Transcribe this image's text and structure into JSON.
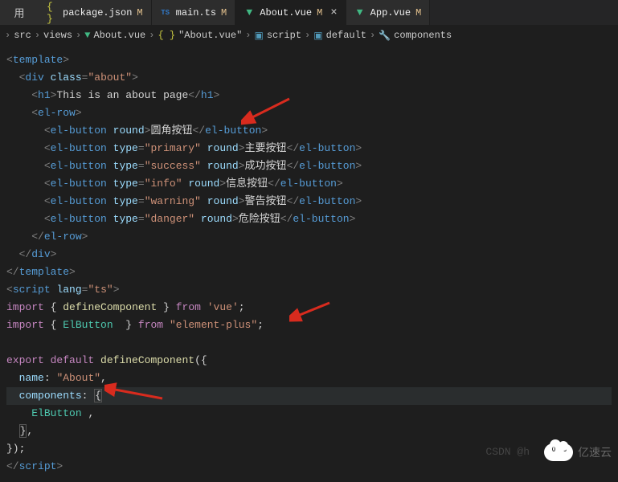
{
  "tabs": {
    "first": "用",
    "items": [
      {
        "icon": "json",
        "label": "package.json",
        "modified": "M",
        "active": false,
        "close": false
      },
      {
        "icon": "ts",
        "label": "main.ts",
        "modified": "M",
        "active": false,
        "close": false
      },
      {
        "icon": "vue",
        "label": "About.vue",
        "modified": "M",
        "active": true,
        "close": true
      },
      {
        "icon": "vue",
        "label": "App.vue",
        "modified": "M",
        "active": false,
        "close": false
      }
    ]
  },
  "breadcrumb": {
    "sep": "›",
    "items": [
      "src",
      "views",
      "About.vue",
      "\"About.vue\"",
      "script",
      "default",
      "components"
    ],
    "icons": [
      "",
      "",
      "vue",
      "braces",
      "cube",
      "cube",
      "wrench"
    ]
  },
  "code": {
    "l1": {
      "tag": "template"
    },
    "l2": {
      "tag": "div",
      "attr": "class",
      "val": "\"about\""
    },
    "l3": {
      "tag": "h1",
      "text": "This is an about page"
    },
    "l4": {
      "tag": "el-row"
    },
    "l5": {
      "tag": "el-button",
      "attr1": "round",
      "text": "圆角按钮"
    },
    "l6": {
      "tag": "el-button",
      "attr1": "type",
      "val1": "\"primary\"",
      "attr2": "round",
      "text": "主要按钮"
    },
    "l7": {
      "tag": "el-button",
      "attr1": "type",
      "val1": "\"success\"",
      "attr2": "round",
      "text": "成功按钮"
    },
    "l8": {
      "tag": "el-button",
      "attr1": "type",
      "val1": "\"info\"",
      "attr2": "round",
      "text": "信息按钮"
    },
    "l9": {
      "tag": "el-button",
      "attr1": "type",
      "val1": "\"warning\"",
      "attr2": "round",
      "text": "警告按钮"
    },
    "l10": {
      "tag": "el-button",
      "attr1": "type",
      "val1": "\"danger\"",
      "attr2": "round",
      "text": "危险按钮"
    },
    "l11": {
      "close": "el-row"
    },
    "l12": {
      "close": "div"
    },
    "l13": {
      "close": "template"
    },
    "l14": {
      "tag": "script",
      "attr": "lang",
      "val": "\"ts\""
    },
    "l15": {
      "kw": "import",
      "brace1": "{",
      "var": "defineComponent",
      "brace2": "}",
      "from": "from",
      "src": "'vue'"
    },
    "l16": {
      "kw": "import",
      "brace1": "{",
      "var": "ElButton",
      "brace2": "}",
      "from": "from",
      "src": "\"element-plus\""
    },
    "l17": {
      "kw1": "export",
      "kw2": "default",
      "fn": "defineComponent",
      "open": "({"
    },
    "l18": {
      "prop": "name",
      "val": "\"About\""
    },
    "l19": {
      "prop": "components",
      "open": "{"
    },
    "l20": {
      "var": "ElButton"
    },
    "l21": {
      "close": "}"
    },
    "l22": {
      "close": "});"
    },
    "l23": {
      "close": "script"
    }
  },
  "watermark": {
    "csdn": "CSDN @h",
    "brand": "亿速云"
  }
}
